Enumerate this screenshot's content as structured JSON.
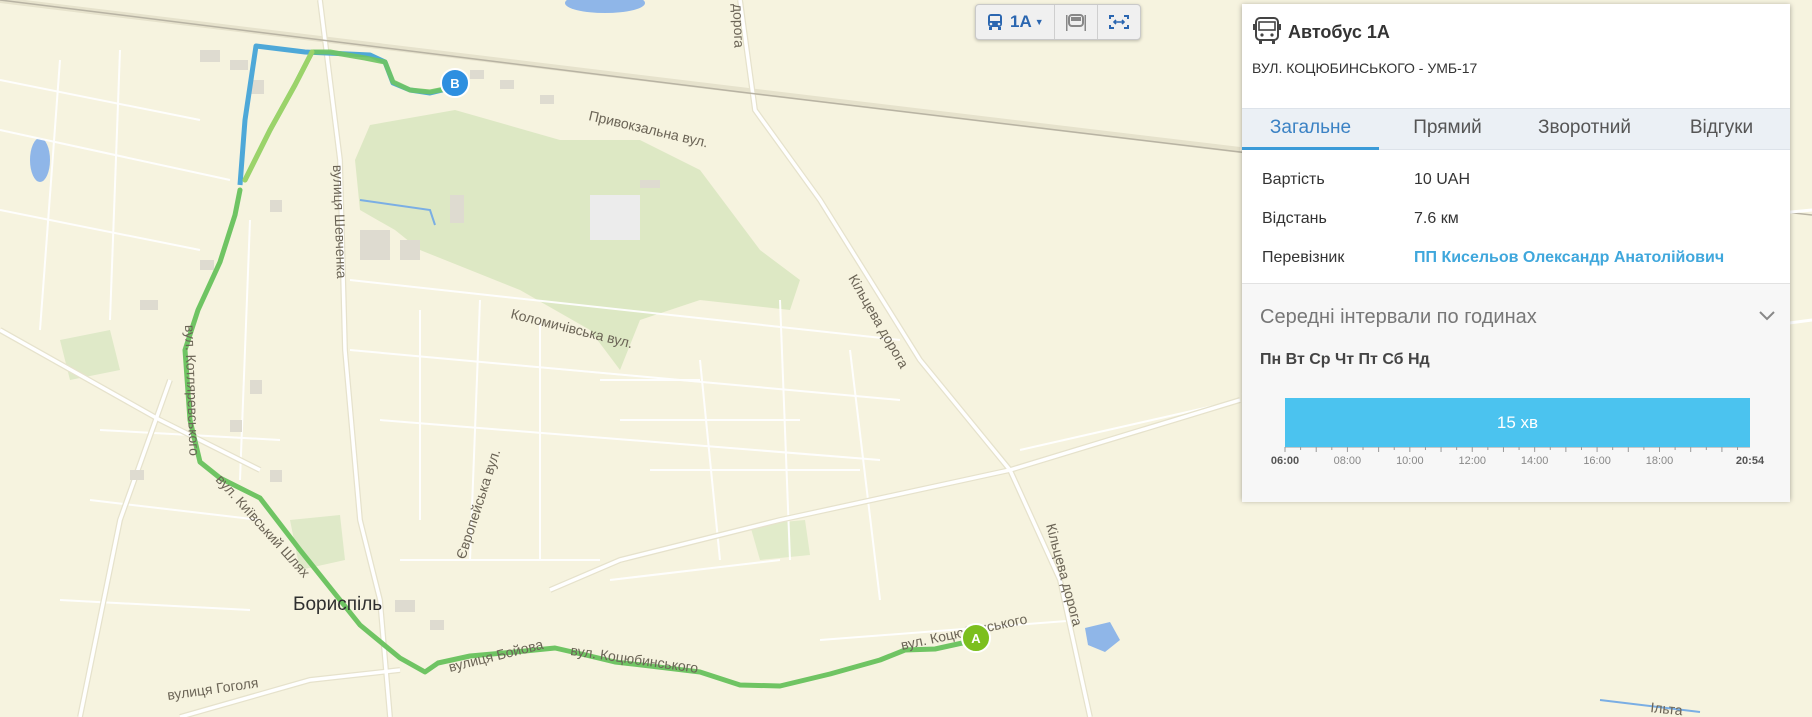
{
  "map": {
    "city_label": "Бориспіль",
    "street_labels": [
      "Привокзальна вул.",
      "вулиця Шевченка",
      "Коломичівська вул.",
      "Кільцева дорога",
      "Кільцева дорога",
      "дорога",
      "Європейська вул.",
      "вулиця Гоголя",
      "вул. Котляревського",
      "вул. Київський Шлях",
      "вулиця Бойова",
      "вул. Коцюбинського",
      "вул. Коцюбинського",
      "Ільта"
    ],
    "marker_start": "A",
    "marker_end": "B",
    "colors": {
      "route_green": "#6fc463",
      "route_blue": "#4ea8d8",
      "marker_a": "#7cbf1e",
      "marker_b": "#2e8fe0"
    }
  },
  "toolbar": {
    "route_label": "1A",
    "bus_icon": "bus-icon",
    "stops_icon": "bus-stop-icon",
    "fit_icon": "fit-bounds-icon"
  },
  "panel": {
    "title": "Автобус 1А",
    "subtitle": "ВУЛ. КОЦЮБИНСЬКОГО - УМБ-17",
    "tabs": [
      "Загальне",
      "Прямий",
      "Зворотний",
      "Відгуки"
    ],
    "active_tab": 0,
    "info": [
      {
        "label": "Вартість",
        "value": "10 UAH"
      },
      {
        "label": "Відстань",
        "value": "7.6 км"
      },
      {
        "label": "Перевізник",
        "value": "ПП Кисельов Олександр Анатолійович"
      }
    ],
    "intervals": {
      "title": "Середні інтервали по годинах",
      "days": "Пн Вт Ср Чт Пт Сб Нд",
      "bar_label": "15 хв",
      "axis_labels": [
        "06:00",
        "08:00",
        "10:00",
        "12:00",
        "14:00",
        "16:00",
        "18:00",
        "20:54"
      ],
      "accent": "#4bc3ef"
    }
  }
}
